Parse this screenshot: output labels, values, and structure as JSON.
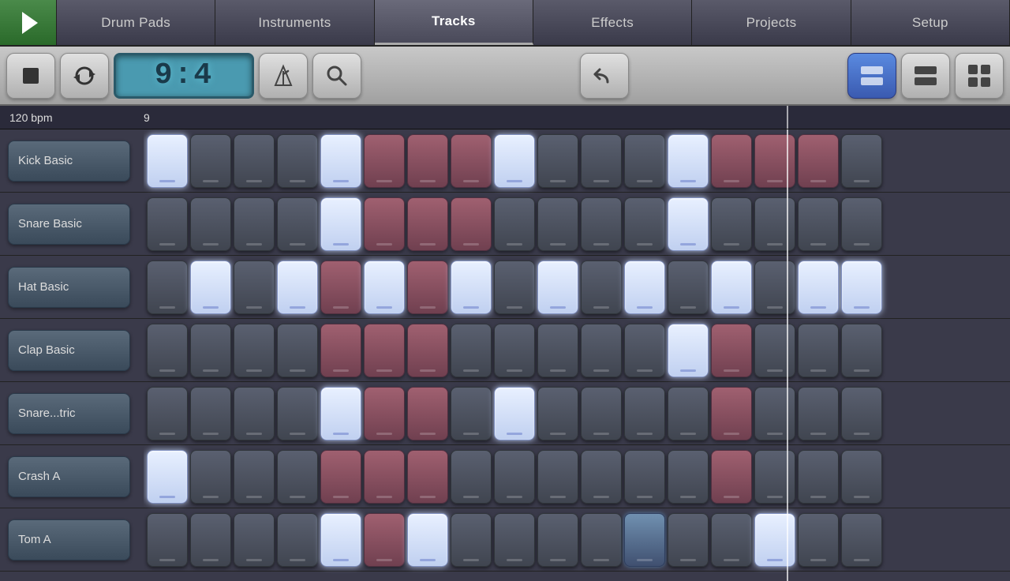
{
  "nav": {
    "tabs": [
      {
        "id": "drum-pads",
        "label": "Drum Pads",
        "active": false
      },
      {
        "id": "instruments",
        "label": "Instruments",
        "active": false
      },
      {
        "id": "tracks",
        "label": "Tracks",
        "active": true
      },
      {
        "id": "effects",
        "label": "Effects",
        "active": false
      },
      {
        "id": "projects",
        "label": "Projects",
        "active": false
      },
      {
        "id": "setup",
        "label": "Setup",
        "active": false
      }
    ]
  },
  "toolbar": {
    "stop_label": "■",
    "loop_label": "↺",
    "display_value": "9:4",
    "bpm": "120 bpm",
    "measure_number": "9"
  },
  "tracks": [
    {
      "id": "kick-basic",
      "label": "Kick Basic"
    },
    {
      "id": "snare-basic",
      "label": "Snare Basic"
    },
    {
      "id": "hat-basic",
      "label": "Hat Basic"
    },
    {
      "id": "clap-basic",
      "label": "Clap Basic"
    },
    {
      "id": "snare-elec",
      "label": "Snare...tric"
    },
    {
      "id": "crash-a",
      "label": "Crash A"
    },
    {
      "id": "tom-a",
      "label": "Tom A"
    }
  ],
  "grid": {
    "kick_row": [
      "on-white",
      "off",
      "off",
      "off",
      "on-white",
      "on-rose",
      "on-rose",
      "on-rose",
      "on-white",
      "off",
      "off",
      "off",
      "on-white",
      "on-rose",
      "on-rose",
      "on-rose",
      "off"
    ],
    "snare_row": [
      "off",
      "off",
      "off",
      "off",
      "on-white",
      "on-rose",
      "on-rose",
      "on-rose",
      "off",
      "off",
      "off",
      "off",
      "on-white",
      "off",
      "off",
      "off",
      "off"
    ],
    "hat_row": [
      "off",
      "on-white",
      "off",
      "on-white",
      "on-rose",
      "on-white",
      "on-rose",
      "on-white",
      "off",
      "on-white",
      "off",
      "on-white",
      "off",
      "on-white",
      "off",
      "on-white",
      "on-white"
    ],
    "clap_row": [
      "off",
      "off",
      "off",
      "off",
      "on-rose",
      "on-rose",
      "on-rose",
      "off",
      "off",
      "off",
      "off",
      "off",
      "on-white",
      "on-rose",
      "off",
      "off",
      "off"
    ],
    "snare_e_row": [
      "off",
      "off",
      "off",
      "off",
      "on-white",
      "on-rose",
      "on-rose",
      "off",
      "on-white",
      "off",
      "off",
      "off",
      "off",
      "on-rose",
      "off",
      "off",
      "off"
    ],
    "crash_row": [
      "on-white",
      "off",
      "off",
      "off",
      "on-rose",
      "on-rose",
      "on-rose",
      "off",
      "off",
      "off",
      "off",
      "off",
      "off",
      "on-rose",
      "off",
      "off",
      "off"
    ],
    "tom_row": [
      "off",
      "off",
      "off",
      "off",
      "on-white",
      "on-rose",
      "on-white",
      "off",
      "off",
      "off",
      "off",
      "on-blue",
      "off",
      "off",
      "on-white",
      "off",
      "off"
    ]
  }
}
